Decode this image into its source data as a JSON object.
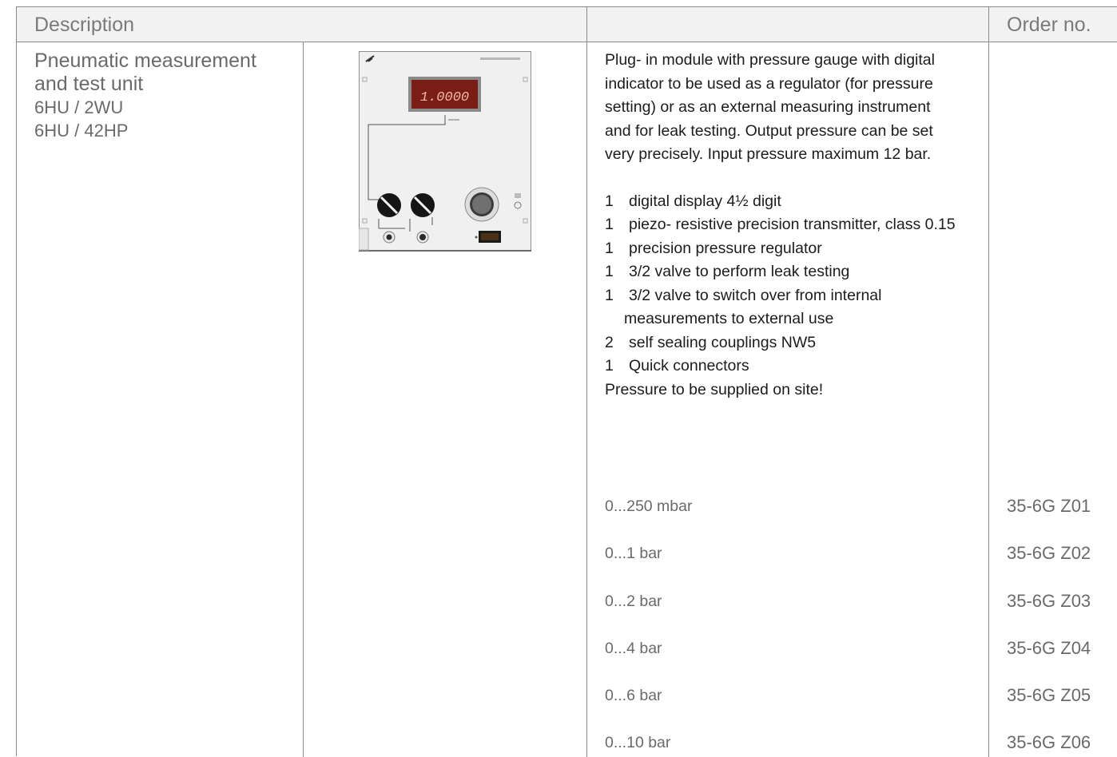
{
  "header": {
    "description_label": "Description",
    "order_label": "Order no."
  },
  "product": {
    "name_line1": "Pneumatic measurement",
    "name_line2": "and test unit",
    "size1": "6HU / 2WU",
    "size2": "6HU / 42HP"
  },
  "device_display": {
    "reading": "1.0000"
  },
  "description": {
    "intro": [
      "Plug- in module with pressure gauge with digital",
      "indicator to be used as a regulator (for pressure",
      "setting) or as an external measuring instrument",
      "and for leak testing. Output pressure can be set",
      "very precisely. Input pressure maximum 12 bar."
    ],
    "items": [
      {
        "qty": "1",
        "text": "digital display 4½ digit"
      },
      {
        "qty": "1",
        "text": "piezo- resistive precision transmitter, class 0.15"
      },
      {
        "qty": "1",
        "text": "precision pressure regulator"
      },
      {
        "qty": "1",
        "text": "3/2 valve to perform leak testing"
      },
      {
        "qty": "1",
        "text": "3/2 valve to switch over from internal"
      },
      {
        "qty": "",
        "text": "measurements to external use"
      },
      {
        "qty": "2",
        "text": "self sealing couplings NW5"
      },
      {
        "qty": "1",
        "text": "Quick connectors"
      }
    ],
    "note": "Pressure to be supplied on site!"
  },
  "variants": [
    {
      "range": "0...250 mbar",
      "order_no": "35-6G Z01"
    },
    {
      "range": "0...1 bar",
      "order_no": "35-6G Z02"
    },
    {
      "range": "0...2 bar",
      "order_no": "35-6G Z03"
    },
    {
      "range": "0...4 bar",
      "order_no": "35-6G Z04"
    },
    {
      "range": "0...6 bar",
      "order_no": "35-6G Z05"
    },
    {
      "range": "0...10 bar",
      "order_no": "35-6G Z06"
    }
  ]
}
